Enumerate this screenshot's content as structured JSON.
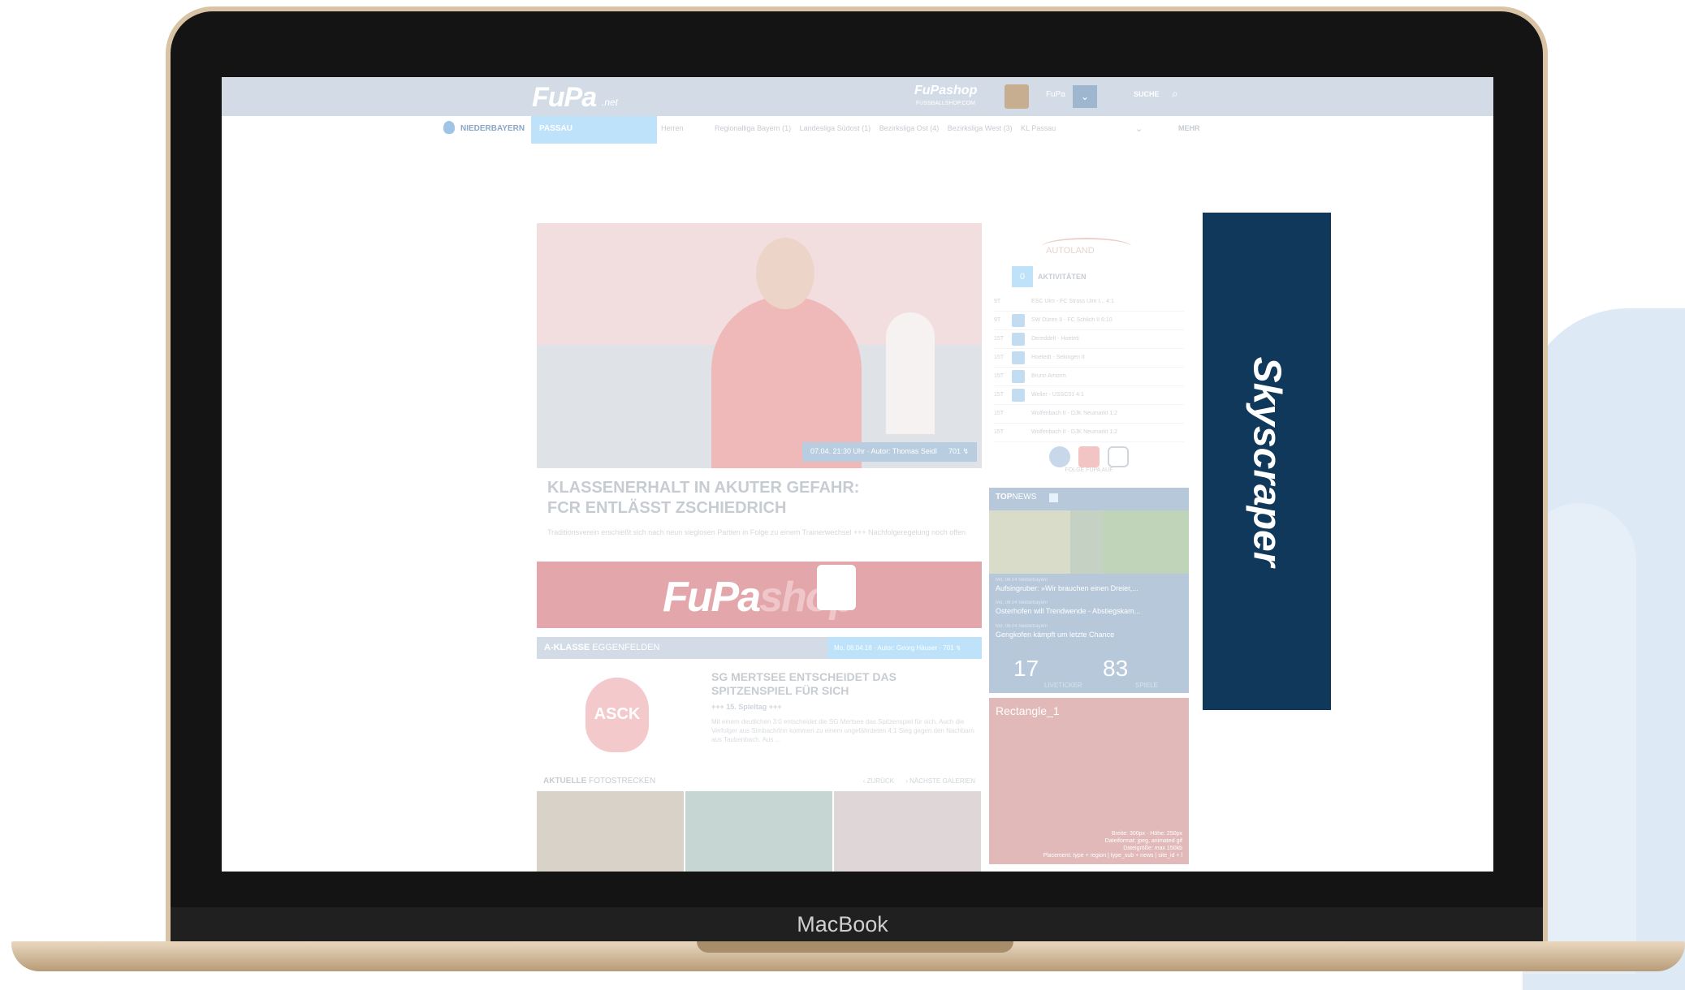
{
  "device": {
    "label": "MacBook"
  },
  "header": {
    "logo": "FuPa",
    "logo_suffix": ".net",
    "shop_logo": "FuPashop",
    "shop_sub": "FUSSBALLSHOP.COM",
    "user_name": "FuPa",
    "user_toggle": "⌄",
    "search_label": "SUCHE",
    "search_icon": "⌕"
  },
  "subnav": {
    "region": "NIEDERBAYERN",
    "active_tab": "PASSAU",
    "links": [
      "Herren",
      "Regionalliga Bayern (1)",
      "Landesliga Südost (1)",
      "Bezirksliga Ost (4)",
      "Bezirksliga West (3)",
      "KL Passau"
    ],
    "chevron": "⌄",
    "more": "MEHR"
  },
  "hero": {
    "meta": "07.04. 21:30 Uhr · Autor: Thomas Seidl",
    "count": "701 ↯",
    "headline_line1": "KLASSENERHALT IN AKUTER GEFAHR:",
    "headline_line2": "FCR ENTLÄSST ZSCHIEDRICH",
    "teaser": "Traditionsverein erschießt sich nach neun sieglosen Partien in Folge zu einem Trainerwechsel +++ Nachfolgeregelung noch offen"
  },
  "shop_banner": {
    "fu": "FuPa",
    "shop": "shop"
  },
  "league_article": {
    "league_bold": "A-KLASSE",
    "league_rest": "EGGENFELDEN",
    "meta": "Mo, 08.04.18 · Autor: Georg Häuser · 701 ↯",
    "badge": "ASCK",
    "title": "SG MERTSEE ENTSCHEIDET DAS SPITZENSPIEL FÜR SICH",
    "subtitle": "+++ 15. Spieltag +++",
    "text": "Mit einem deutlichen 3:0 entscheidet die SG Mertsee das Spitzenspiel für sich. Auch die Verfolger aus Simbach/Inn kommen zu einem ungefährdeten 4:1 Sieg gegen den Nachbarn aus Taubenbach. Aus ..."
  },
  "gallery": {
    "title_bold": "AKTUELLE",
    "title_rest": "FOTOSTRECKEN",
    "prev": "‹ ZURÜCK",
    "next": "› NÄCHSTE GALERIEN"
  },
  "sidebar": {
    "sponsor": "AUTOLAND",
    "activity_count": "0",
    "activity_title": "AKTIVITÄTEN",
    "activities": [
      {
        "time": "9T",
        "text": "ESC Ulm - FC Strass Ulm I... 4:1"
      },
      {
        "time": "9T",
        "text": "SW Düren II - FC Schlich II 6:10"
      },
      {
        "time": "15T",
        "text": "Dereddelt - Hoeteti"
      },
      {
        "time": "15T",
        "text": "Hoetedt - Sekingen II"
      },
      {
        "time": "15T",
        "text": "Brunn Amorm"
      },
      {
        "time": "15T",
        "text": "Weiler - USSC01 4:1"
      },
      {
        "time": "15T",
        "text": "Wolfenbach II - DJK Neumarkt 1:2"
      },
      {
        "time": "15T",
        "text": "Wolfenbach II - DJK Neumarkt 1:2"
      }
    ],
    "social_label": "FOLGE FUPA AUF"
  },
  "topnews": {
    "head_bold": "TOP",
    "head_rest": "NEWS",
    "items": [
      {
        "meta": "Mo, 08.04 Niederbayern",
        "title": "Aufsingruber: »Wir brauchen einen Dreier,..."
      },
      {
        "meta": "Mo, 08.04 Niederbayern",
        "title": "Osterhofen will Trendwende - Abstiegskam..."
      },
      {
        "meta": "Mo, 08.04 Niederbayern",
        "title": "Gengkofen kämpft um letzte Chance"
      }
    ],
    "live_count": "17",
    "live_label": "LIVETICKER",
    "games_count": "83",
    "games_label": "SPIELE"
  },
  "rectangle": {
    "label": "Rectangle_1",
    "info_lines": [
      "Breite: 300px · Höhe: 250px",
      "Dateiformat: jpeg, animated gif",
      "Dateigröße: max 150kb",
      "Placement: type + region | type_sub + news | site_id + l"
    ]
  },
  "skyscraper": {
    "label": "Skyscraper"
  },
  "colors": {
    "skyscraper_bg": "#10385a",
    "topbar_bg": "#d3dce6",
    "active_tab": "#bde2f9",
    "shop_banner": "#e3a7ab"
  }
}
